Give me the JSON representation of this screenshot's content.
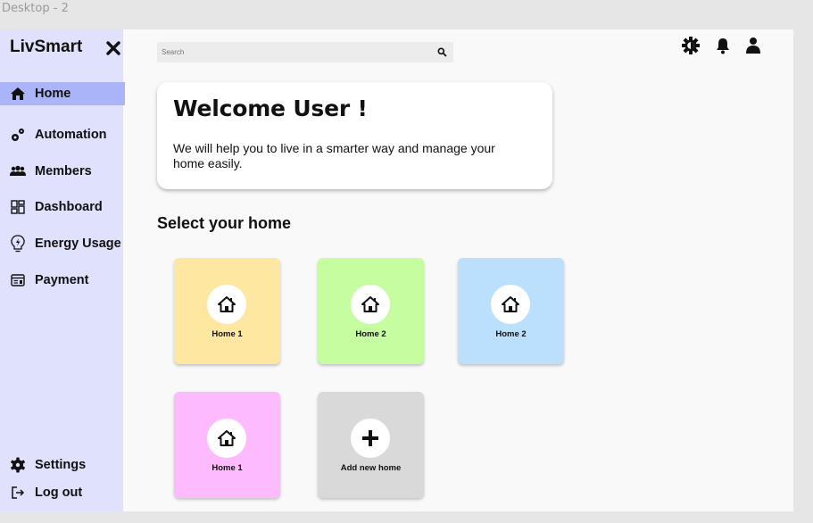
{
  "frame_label": "Desktop - 2",
  "sidebar": {
    "brand": "LivSmart",
    "close_icon": "close-icon",
    "items": [
      {
        "label": "Home",
        "icon": "home-icon",
        "active": true
      },
      {
        "label": "Automation",
        "icon": "gears-icon",
        "active": false
      },
      {
        "label": "Members",
        "icon": "users-icon",
        "active": false
      },
      {
        "label": "Dashboard",
        "icon": "dashboard-icon",
        "active": false
      },
      {
        "label": "Energy Usage",
        "icon": "energy-bulb-icon",
        "active": false
      },
      {
        "label": "Payment",
        "icon": "receipt-icon",
        "active": false
      }
    ],
    "bottom_items": [
      {
        "label": "Settings",
        "icon": "gear-icon"
      },
      {
        "label": "Log out",
        "icon": "logout-icon"
      }
    ]
  },
  "header": {
    "search_placeholder": "Search",
    "icons": [
      "brightness-icon",
      "bell-icon",
      "user-icon"
    ]
  },
  "welcome": {
    "title": "Welcome User !",
    "message": "We will help you to live in a smarter way and manage your home easily."
  },
  "homes_section": {
    "title": "Select your home",
    "homes": [
      {
        "label": "Home 1",
        "color": "#fee8a1"
      },
      {
        "label": "Home 2",
        "color": "#c7fda1"
      },
      {
        "label": "Home 2",
        "color": "#bae0fd"
      },
      {
        "label": "Home 1",
        "color": "#fdbafd"
      }
    ],
    "add_new": {
      "label": "Add new home",
      "color": "#d9d9d9"
    }
  },
  "colors": {
    "sidebar_bg": "#dfe1fd",
    "active_item": "#aab4f8",
    "page_bg": "#f9f9f9"
  }
}
